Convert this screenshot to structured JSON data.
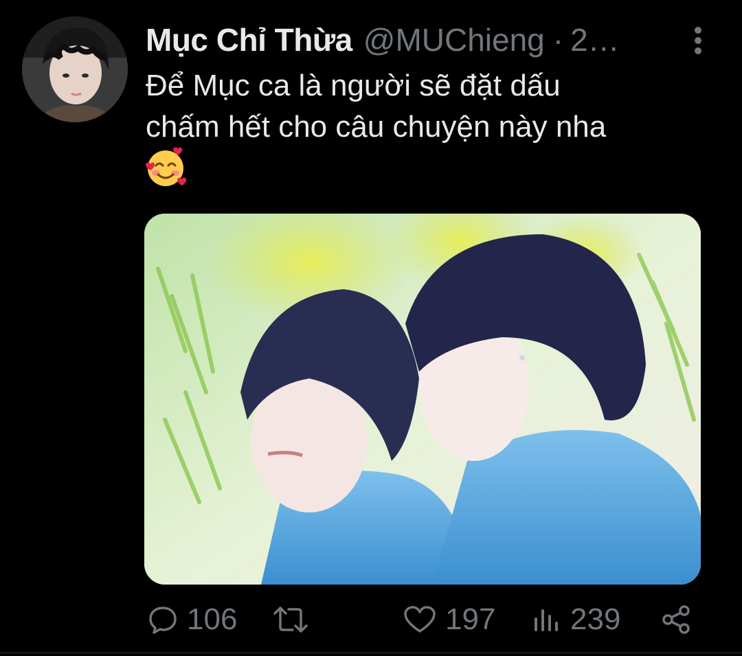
{
  "tweet": {
    "display_name": "Mục Chỉ Thừa",
    "handle": "@MUChieng",
    "separator": "·",
    "time": "2…",
    "text_line1": "Để Mục ca là người sẽ đặt dấu",
    "text_line2": "chấm hết cho câu chuyện này nha",
    "emoji": "smiling-face-with-hearts"
  },
  "actions": {
    "reply_count": "106",
    "retweet_count": "",
    "like_count": "197",
    "views_count": "239"
  },
  "icons": {
    "more": "more-vertical-icon",
    "reply": "reply-icon",
    "retweet": "retweet-icon",
    "like": "heart-icon",
    "views": "views-icon",
    "share": "share-icon"
  },
  "colors": {
    "background": "#000000",
    "primary_text": "#e7e9ea",
    "secondary_text": "#71767b"
  }
}
